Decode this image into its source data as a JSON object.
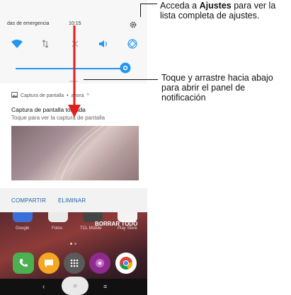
{
  "status_bar": {
    "carrier": "das de emergencia",
    "time": "10:15"
  },
  "quick_settings": {
    "icons": [
      "wifi-icon",
      "data-arrows-icon",
      "airplane-icon",
      "sound-icon",
      "auto-rotate-icon"
    ],
    "settings_icon": "gear-icon",
    "brightness_icon": "brightness-icon",
    "accent": "#2196f3"
  },
  "notification": {
    "app": "Captura de pantalla",
    "time_separator": "•",
    "time": "ahora",
    "expand_glyph": "^",
    "title": "Captura de pantalla tomada",
    "text": "Toque para ver la captura de pantalla",
    "actions": {
      "share": "COMPARTIR",
      "delete": "ELIMINAR"
    }
  },
  "home": {
    "apps": [
      "Google",
      "Fotos",
      "TCL Mobile",
      "Play Store"
    ],
    "clear_all": "BORRAR TODO",
    "nav": {
      "back": "‹",
      "home": "○",
      "recents": "≡"
    }
  },
  "annotations": {
    "settings": {
      "pre": "Acceda a ",
      "bold": "Ajustes",
      "post": " para ver la lista completa de ajustes."
    },
    "drag": "Toque y arrastre hacia abajo para abrir el panel de notificación"
  },
  "colors": {
    "arrow": "#e0201b",
    "link": "#1f5fa8"
  }
}
